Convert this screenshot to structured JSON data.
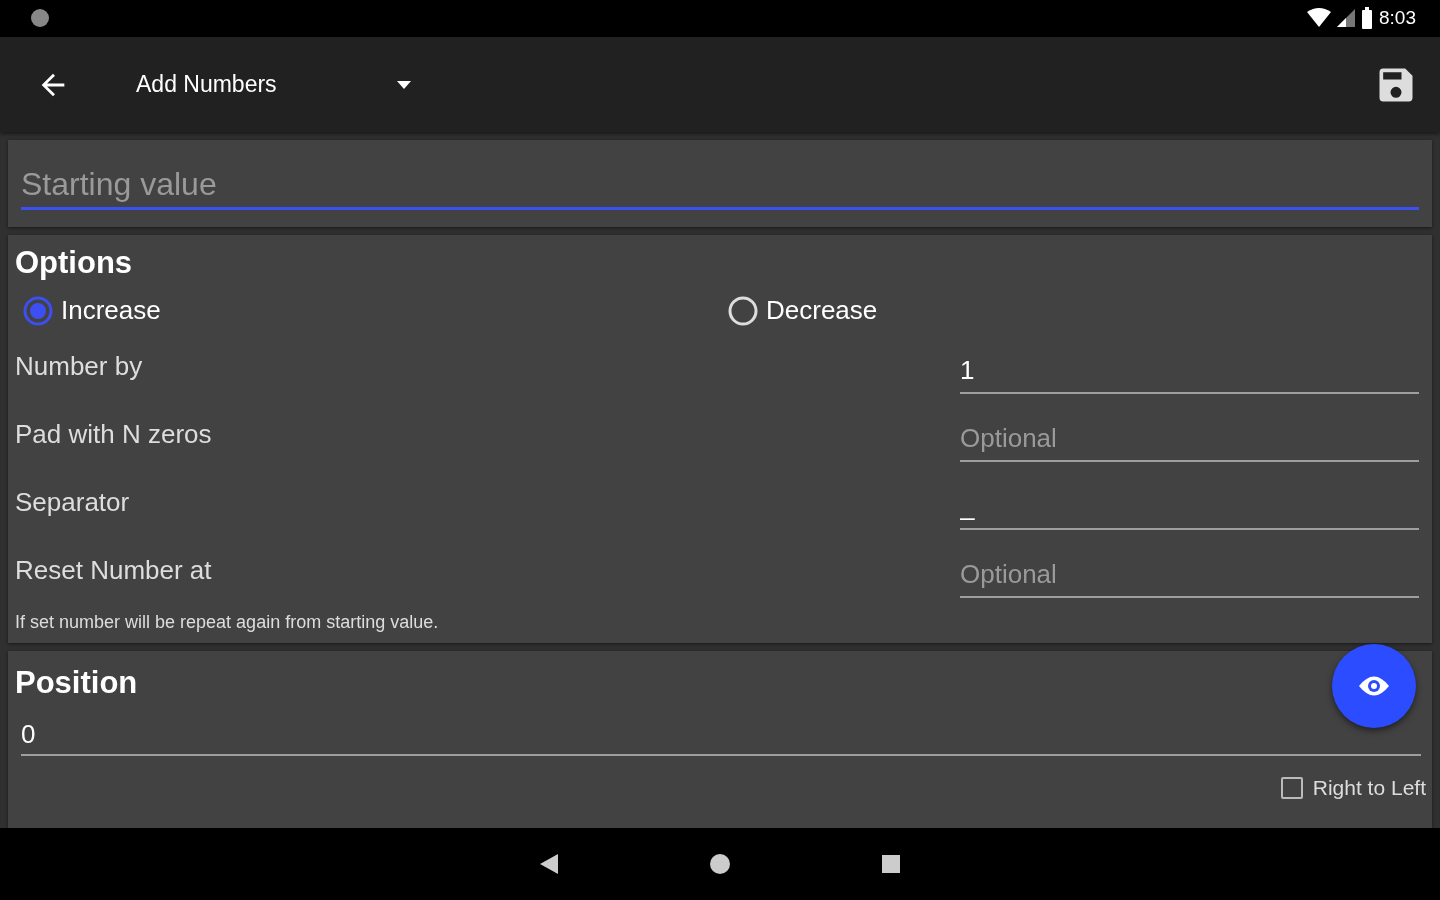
{
  "status_bar": {
    "time": "8:03"
  },
  "toolbar": {
    "title": "Add Numbers"
  },
  "starting_value": {
    "placeholder": "Starting value",
    "focused": true
  },
  "options": {
    "title": "Options",
    "radios": [
      {
        "label": "Increase",
        "selected": true
      },
      {
        "label": "Decrease",
        "selected": false
      }
    ],
    "fields": [
      {
        "label": "Number by",
        "value": "1"
      },
      {
        "label": "Pad with N zeros",
        "placeholder": "Optional"
      },
      {
        "label": "Separator",
        "value": "_"
      },
      {
        "label": "Reset Number at",
        "placeholder": "Optional"
      }
    ],
    "hint": "If set number will be repeat again from starting value."
  },
  "position": {
    "title": "Position",
    "value": "0",
    "right_to_left": {
      "label": "Right to Left",
      "checked": false
    }
  }
}
